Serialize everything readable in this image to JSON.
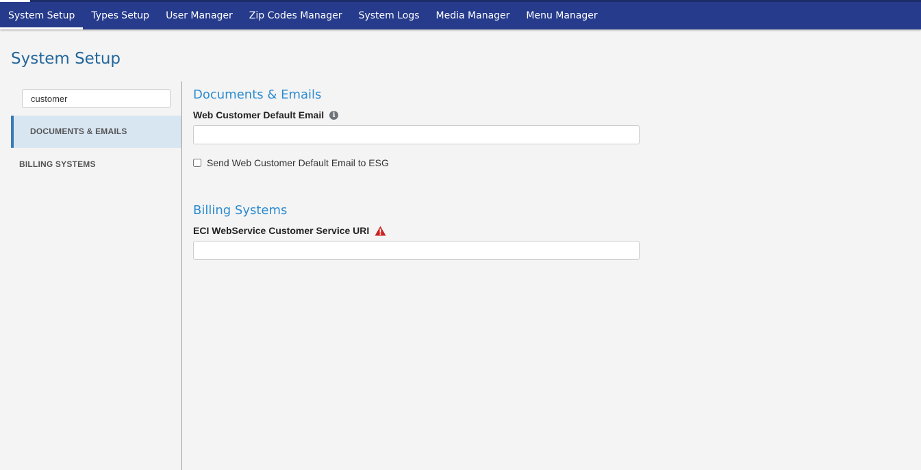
{
  "nav": {
    "items": [
      {
        "label": "System Setup",
        "active": true
      },
      {
        "label": "Types Setup",
        "active": false
      },
      {
        "label": "User Manager",
        "active": false
      },
      {
        "label": "Zip Codes Manager",
        "active": false
      },
      {
        "label": "System Logs",
        "active": false
      },
      {
        "label": "Media Manager",
        "active": false
      },
      {
        "label": "Menu Manager",
        "active": false
      }
    ]
  },
  "page": {
    "title": "System Setup"
  },
  "sidebar": {
    "search": {
      "value": "customer",
      "placeholder": ""
    },
    "items": [
      {
        "label": "DOCUMENTS & EMAILS",
        "active": true
      },
      {
        "label": "BILLING SYSTEMS",
        "active": false
      }
    ]
  },
  "main": {
    "sections": [
      {
        "title": "Documents & Emails",
        "field_label": "Web Customer Default Email",
        "field_icon": "info-icon",
        "field_value": "",
        "checkbox_label": "Send Web Customer Default Email to ESG",
        "checkbox_checked": false
      },
      {
        "title": "Billing Systems",
        "field_label": "ECI WebService Customer Service URI",
        "field_icon": "warning-icon",
        "field_value": ""
      }
    ]
  },
  "colors": {
    "nav_bg": "#263b8c",
    "page_title": "#23669a",
    "section_title": "#2b8bd0",
    "active_sidebar_bg": "#d8e6f2",
    "active_sidebar_border": "#3a7ab5",
    "warning": "#cc1f1f"
  }
}
